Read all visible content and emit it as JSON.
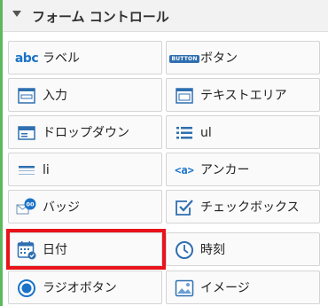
{
  "panel": {
    "title": "フォーム コントロール"
  },
  "controls": [
    {
      "label": "ラベル",
      "icon": "label-abc-icon"
    },
    {
      "label": "ボタン",
      "icon": "button-icon",
      "icon_text": "BUTTON"
    },
    {
      "label": "入力",
      "icon": "input-icon"
    },
    {
      "label": "テキストエリア",
      "icon": "textarea-icon"
    },
    {
      "label": "ドロップダウン",
      "icon": "dropdown-icon"
    },
    {
      "label": "ul",
      "icon": "unordered-list-icon"
    },
    {
      "label": "li",
      "icon": "list-item-icon"
    },
    {
      "label": "アンカー",
      "icon": "anchor-icon",
      "icon_text": "<a>"
    },
    {
      "label": "バッジ",
      "icon": "badge-icon",
      "icon_text": "00"
    },
    {
      "label": "チェックボックス",
      "icon": "checkbox-icon"
    },
    {
      "label": "日付",
      "icon": "calendar-icon"
    },
    {
      "label": "時刻",
      "icon": "clock-icon"
    },
    {
      "label": "ラジオボタン",
      "icon": "radio-button-icon"
    },
    {
      "label": "イメージ",
      "icon": "image-icon"
    }
  ],
  "highlighted": "日付",
  "colors": {
    "accent": "#1a73c8",
    "highlight": "#e8131b",
    "left_rail": "#5cb85c"
  }
}
